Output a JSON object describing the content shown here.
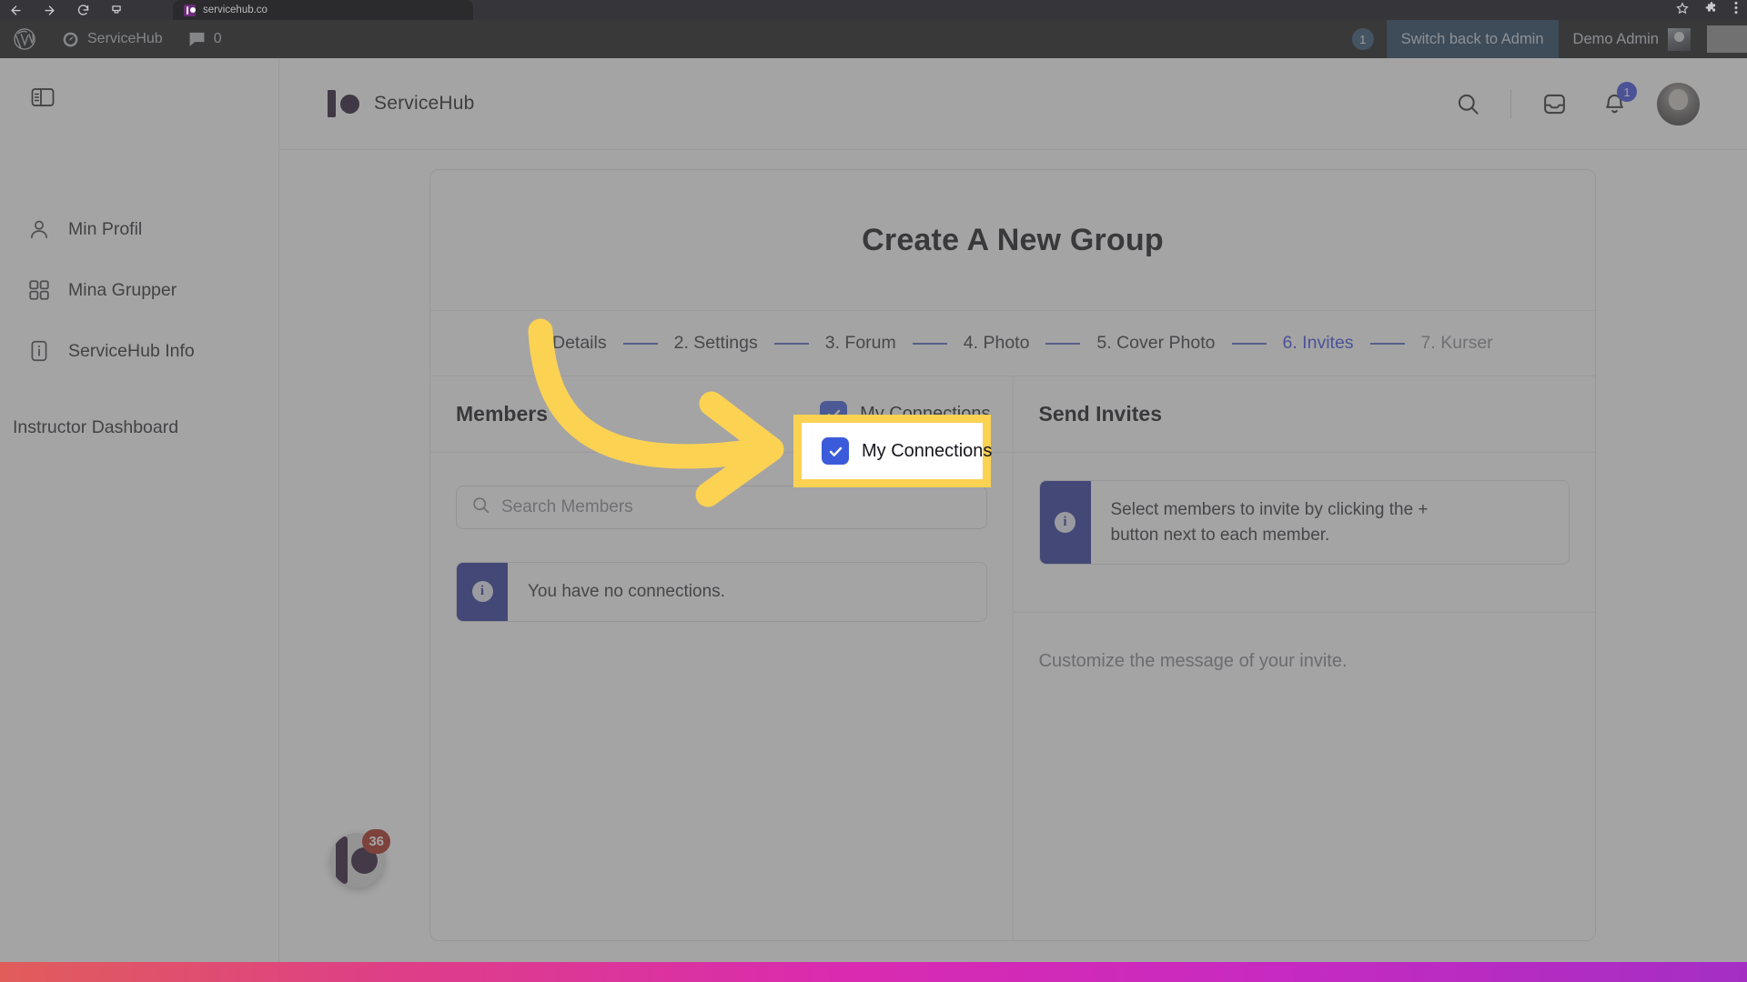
{
  "browser": {
    "tab_title": "servicehub.co",
    "nav_icons": [
      "back-arrow-icon",
      "forward-arrow-icon",
      "reload-icon",
      "download-icon"
    ],
    "right_icons": [
      "bookmark-star-icon",
      "extensions-icon",
      "menu-kebab-icon"
    ]
  },
  "adminbar": {
    "wp_logo": "wordpress-logo-icon",
    "site_name": "ServiceHub",
    "comments_count": "0",
    "updates_count": "1",
    "switch_back_label": "Switch back to Admin",
    "user_name": "Demo Admin"
  },
  "sidebar": {
    "toggle_icon": "panel-toggle-icon",
    "items": [
      {
        "label": "Min Profil",
        "icon": "user-icon"
      },
      {
        "label": "Mina Grupper",
        "icon": "grid-icon"
      },
      {
        "label": "ServiceHub Info",
        "icon": "info-card-icon"
      }
    ],
    "instructor_dashboard": "Instructor Dashboard"
  },
  "header": {
    "brand_name": "ServiceHub",
    "search_icon": "search-icon",
    "inbox_icon": "inbox-icon",
    "bell_icon": "bell-icon",
    "bell_badge": "1",
    "avatar": "user-avatar"
  },
  "wizard": {
    "title": "Create A New Group",
    "steps": [
      {
        "label": "1. Details",
        "state": "done"
      },
      {
        "label": "2. Settings",
        "state": "done"
      },
      {
        "label": "3. Forum",
        "state": "done"
      },
      {
        "label": "4. Photo",
        "state": "done"
      },
      {
        "label": "5. Cover Photo",
        "state": "done"
      },
      {
        "label": "6. Invites",
        "state": "active"
      },
      {
        "label": "7. Kurser",
        "state": "disabled"
      }
    ]
  },
  "members_panel": {
    "title": "Members",
    "my_connections_label": "My Connections",
    "my_connections_checked": true,
    "search_placeholder": "Search Members",
    "search_value": "",
    "search_icon": "search-icon",
    "notice": "You have no connections.",
    "notice_icon": "info-icon"
  },
  "invites_panel": {
    "title": "Send Invites",
    "notice": "Select members to invite by clicking the + button next to each member.",
    "notice_icon": "info-icon",
    "message_placeholder": "Customize the message of your invite."
  },
  "chat_launcher": {
    "badge": "36",
    "icon": "servicehub-logo-icon"
  },
  "annotation": {
    "arrow_color": "#fcd253",
    "highlight_border_color": "#fcd253",
    "highlight_label": "My Connections",
    "arrow_name": "curved-arrow-annotation"
  },
  "colors": {
    "accent_blue": "#3b49df",
    "checkbox_blue": "#3b5bdb",
    "notice_blue": "#2b3499",
    "brand_plum": "#23102a",
    "highlight_yellow": "#fcd253",
    "badge_red": "#a82617"
  }
}
